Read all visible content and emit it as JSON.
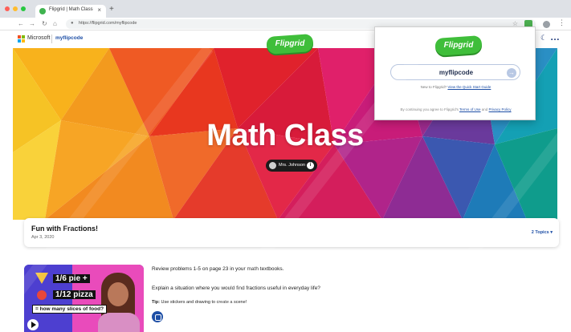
{
  "browser": {
    "tab_title": "Flipgrid | Math Class",
    "tab_close": "×",
    "new_tab": "+",
    "url": "https://flipgrid.com/myflipcode",
    "nav": {
      "back": "←",
      "forward": "→",
      "reload": "↻",
      "home": "⌂"
    }
  },
  "site_header": {
    "microsoft_label": "Microsoft",
    "code_link": "myflipcode"
  },
  "logo": {
    "text": "Flipgrid"
  },
  "hero": {
    "title": "Math Class",
    "teacher": "Mrs. Johnson",
    "info_icon": "i"
  },
  "topic": {
    "title": "Fun with Fractions!",
    "date": "Apr 3, 2020",
    "topics_toggle": "2 Topics ▾"
  },
  "video": {
    "label_1": "1/6 pie +",
    "label_2": "1/12 pizza",
    "label_3": "= how many slices of food?"
  },
  "description": {
    "line_1": "Review problems 1-5 on page 23 in your math textbooks.",
    "line_2": "Explain a situation where you would find fractions useful in everyday life?",
    "tip_label": "Tip:",
    "tip_text": " Use stickers and drawing to create a scene!"
  },
  "join_popup": {
    "code_value": "myflipcode",
    "new_prefix": "New to Flipgrid? ",
    "new_link": "View the Quick Start Guide",
    "legal_prefix": "By continuing you agree to Flipgrid's ",
    "terms_link": "Terms of Use",
    "legal_and": " and ",
    "privacy_link": "Privacy Policy"
  },
  "colors": {
    "brand_green": "#3fbe3a",
    "link_blue": "#1e4fa6"
  },
  "icons": [
    "tab-favicon-icon",
    "close-icon",
    "plus-icon",
    "back-icon",
    "forward-icon",
    "reload-icon",
    "home-icon",
    "lock-icon",
    "star-icon",
    "extension-icon",
    "profile-icon",
    "menu-icon",
    "microsoft-logo-icon",
    "moon-icon",
    "more-icon",
    "info-icon",
    "play-icon",
    "record-icon",
    "arrow-right-icon"
  ]
}
